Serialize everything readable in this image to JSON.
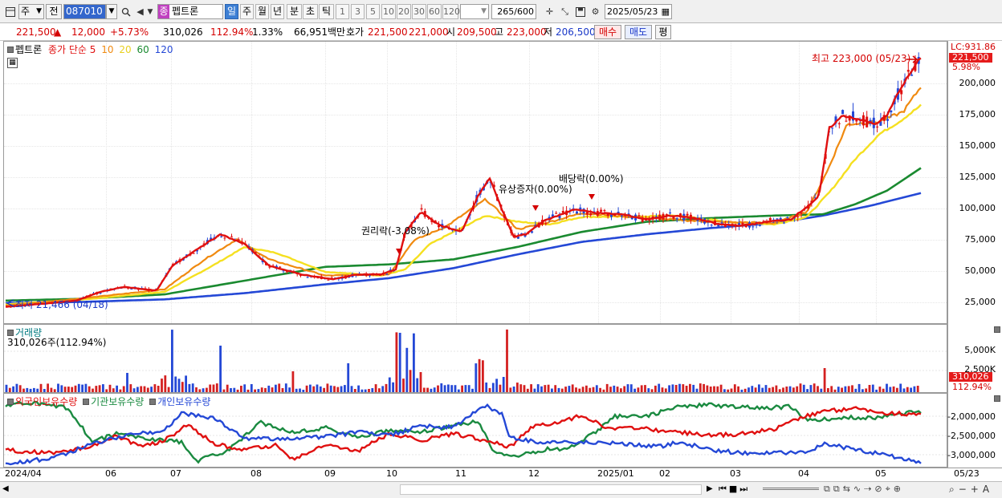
{
  "toolbar": {
    "market": "주",
    "prev_label": "전",
    "code": "087010",
    "stock_type_badge": "종",
    "stock_name": "펩트론",
    "periods": [
      "일",
      "주",
      "월",
      "년",
      "분",
      "초",
      "틱"
    ],
    "numbers": [
      "1",
      "3",
      "5",
      "10",
      "20",
      "30",
      "60",
      "120"
    ],
    "count_value": "265",
    "count_total": "/600",
    "date": "2025/05/23"
  },
  "quote": {
    "price": "221,500",
    "change_arrow": "▲",
    "change": "12,000",
    "change_pct": "+5.73%",
    "volume": "310,026",
    "volume_ratio": "112.94%",
    "turnover": "1.33%",
    "amount": "66,951백만",
    "bid_label": "호가",
    "ask": "221,500",
    "bid": "221,000",
    "open_label": "시",
    "open": "209,500",
    "high_label": "고",
    "high": "223,000",
    "low_label": "저",
    "low": "206,500",
    "buy_label": "매수",
    "sell_label": "매도",
    "eval_label": "평"
  },
  "price_panel": {
    "legend_name": "펩트론",
    "legend_ma": "종가 단순",
    "ma_periods": [
      "5",
      "10",
      "20",
      "60",
      "120"
    ],
    "ma_colors": [
      "#e01010",
      "#f08a10",
      "#f5e020",
      "#1a8a30",
      "#2448d6"
    ],
    "y_labels": [
      "200,000",
      "175,000",
      "150,000",
      "125,000",
      "100,000",
      "75,000",
      "50,000",
      "25,000"
    ],
    "lc_label": "LC:931.86",
    "last_price_tag": "221,500",
    "last_pct_tag": "5.98%",
    "high_annotation": "최고 223,000 (05/23)",
    "low_annotation": "최저 21,466 (04/18)",
    "events": [
      "권리락(-3.08%)",
      "유상증자(0.00%)",
      "배당락(0.00%)"
    ]
  },
  "volume_panel": {
    "title": "거래량",
    "sub": "310,026주(112.94%)",
    "y_labels": [
      "5,000K",
      "2,500K"
    ],
    "tag_value": "310,026",
    "tag_pct": "112.94%"
  },
  "holdings_panel": {
    "series": [
      "외국인보유수량",
      "기관보유수량",
      "개인보유수량"
    ],
    "colors": [
      "#e01010",
      "#1a8a40",
      "#2448d6"
    ],
    "y_labels": [
      "-2,000,000",
      "-2,500,000",
      "-3,000,000"
    ]
  },
  "x_axis": {
    "labels": [
      "2024/04",
      "06",
      "07",
      "08",
      "09",
      "10",
      "11",
      "12",
      "2025/01",
      "02",
      "03",
      "04",
      "05"
    ],
    "right_label": "05/23"
  },
  "chart_data": {
    "type": "line",
    "title": "펩트론",
    "x": [
      "2024/04",
      "06",
      "07",
      "08",
      "09",
      "10",
      "11",
      "12",
      "2025/01",
      "02",
      "03",
      "04",
      "05",
      "05/23"
    ],
    "series": [
      {
        "name": "종가",
        "values": [
          22000,
          32000,
          40000,
          70000,
          50000,
          47000,
          120000,
          80000,
          100000,
          95000,
          90000,
          100000,
          165000,
          221500
        ]
      },
      {
        "name": "60",
        "values": [
          27000,
          28500,
          32000,
          43000,
          55000,
          57000,
          62000,
          75000,
          82000,
          92000,
          95000,
          96000,
          112000,
          133000
        ]
      },
      {
        "name": "120",
        "values": [
          25000,
          26500,
          28000,
          33000,
          40000,
          45000,
          54000,
          65000,
          75000,
          80000,
          85000,
          93000,
          102000,
          113000
        ]
      }
    ],
    "ylim": [
      15000,
      235000
    ]
  }
}
